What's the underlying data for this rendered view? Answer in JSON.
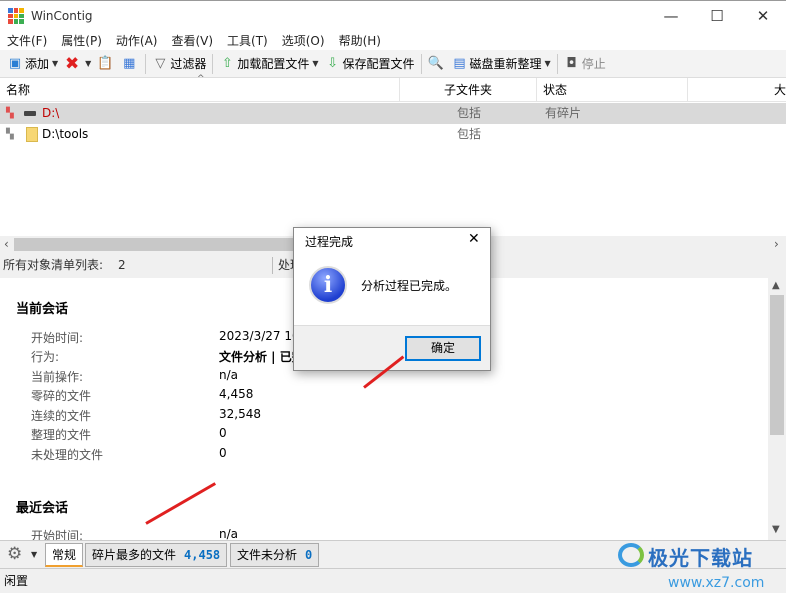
{
  "window": {
    "title": "WinContig",
    "minimize": "—",
    "maximize": "☐",
    "close": "✕"
  },
  "menu": [
    "文件(F)",
    "属性(P)",
    "动作(A)",
    "查看(V)",
    "工具(T)",
    "选项(O)",
    "帮助(H)"
  ],
  "toolbar": {
    "add": "添加",
    "filter": "过滤器",
    "load_profile": "加载配置文件",
    "save_profile": "保存配置文件",
    "defrag": "磁盘重新整理",
    "stop": "停止"
  },
  "list": {
    "columns": [
      "名称",
      "子文件夹",
      "状态",
      "大"
    ],
    "rows": [
      {
        "name": "D:\\",
        "subfolders": "包括",
        "status": "有碎片"
      },
      {
        "name": "D:\\tools",
        "subfolders": "包括",
        "status": ""
      }
    ]
  },
  "summary": {
    "label": "所有对象清单列表:",
    "count": "2",
    "next": "处理"
  },
  "current_session": {
    "title": "当前会话",
    "fields": [
      {
        "label": "开始时间:",
        "value": "2023/3/27 10"
      },
      {
        "label": "行为:",
        "value": "文件分析 | 已完"
      },
      {
        "label": "当前操作:",
        "value": "n/a"
      },
      {
        "label": "零碎的文件",
        "value": "4,458"
      },
      {
        "label": "连续的文件",
        "value": "32,548"
      },
      {
        "label": "整理的文件",
        "value": "0"
      },
      {
        "label": "未处理的文件",
        "value": "0"
      }
    ]
  },
  "recent_session": {
    "title": "最近会话",
    "fields": [
      {
        "label": "开始时间:",
        "value": "n/a"
      }
    ]
  },
  "tabs": [
    {
      "label": "常规"
    },
    {
      "label": "碎片最多的文件",
      "count": "4,458"
    },
    {
      "label": "文件未分析",
      "count": "0"
    }
  ],
  "status": "闲置",
  "dialog": {
    "title": "过程完成",
    "message": "分析过程已完成。",
    "ok": "确定",
    "close": "✕"
  },
  "watermark": {
    "name": "极光下载站",
    "url": "www.xz7.com"
  }
}
